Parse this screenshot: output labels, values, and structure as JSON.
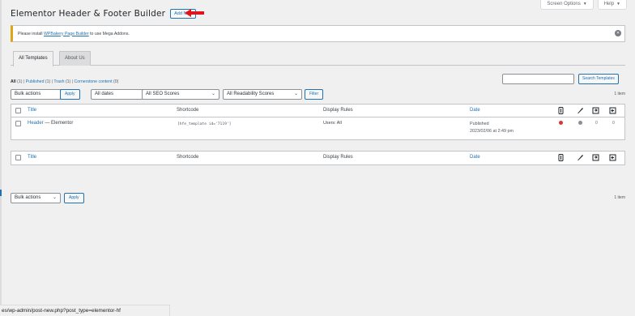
{
  "screen_meta": {
    "options_label": "Screen Options",
    "help_label": "Help"
  },
  "page_title": "Elementor Header & Footer Builder",
  "add_new_label": "Add New",
  "notice": {
    "prefix": "Please install ",
    "link": "WPBakery Page Builder",
    "suffix": " to use Mega Addons."
  },
  "tabs": [
    "All Templates",
    "About Us"
  ],
  "filters": {
    "all": "All",
    "all_count": "(1)",
    "published": "Published",
    "published_count": "(1)",
    "trash": "Trash",
    "trash_count": "(1)",
    "cornerstone": "Cornerstone content",
    "cornerstone_count": "(0)"
  },
  "search_button": "Search Templates",
  "toolbar_top": {
    "bulk_actions": "Bulk actions",
    "apply": "Apply",
    "dates": "All dates",
    "seo": "All SEO Scores",
    "readability": "All Readability Scores",
    "filter": "Filter",
    "items": "1 item"
  },
  "columns": {
    "title": "Title",
    "shortcode": "Shortcode",
    "display_rules": "Display Rules",
    "date": "Date"
  },
  "rows": [
    {
      "title": "Header",
      "suffix": " — Elementor",
      "shortcode": "[hfe_template id='7119']",
      "display_rules": "Users: All",
      "status": "Published",
      "date": "2023/02/06 at 2:49 pm",
      "seo_color": "#d63638",
      "readability_color": "#8c8f94",
      "links_count": "0",
      "linked_count": "0"
    }
  ],
  "toolbar_bottom": {
    "bulk_actions": "Bulk actions",
    "apply": "Apply",
    "items": "1 item"
  },
  "status_url": "es/wp-admin/post-new.php?post_type=elementor-hf"
}
